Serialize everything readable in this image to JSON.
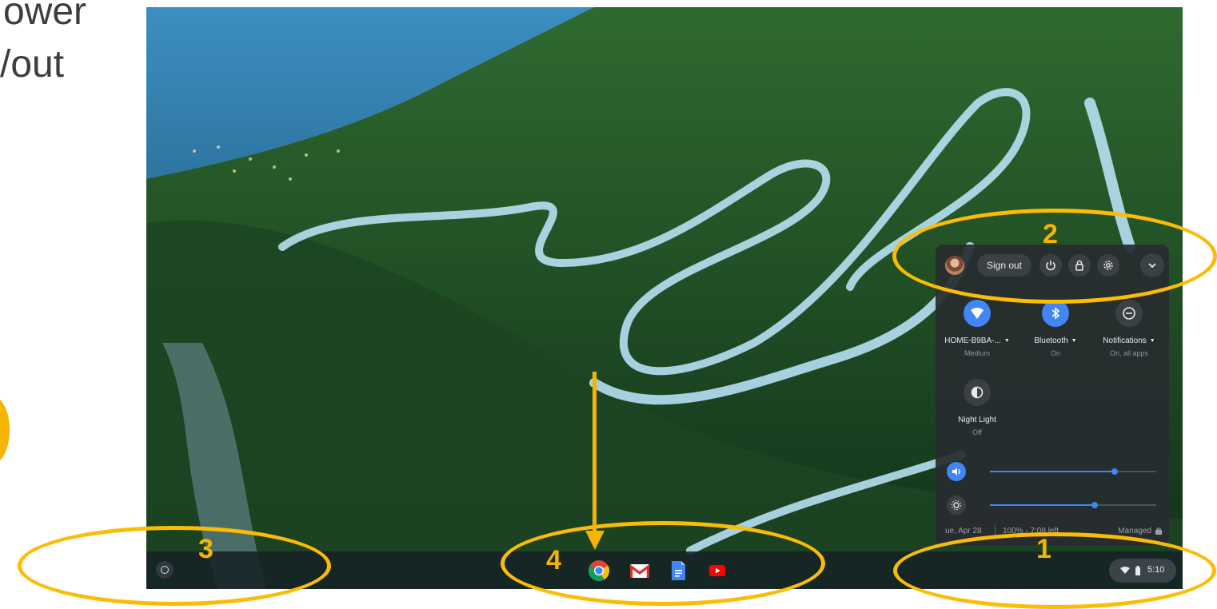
{
  "slide": {
    "lines": [
      "ower",
      "/out"
    ]
  },
  "quick_settings": {
    "sign_out_label": "Sign out",
    "tiles": [
      {
        "label": "HOME-B9BA-...",
        "sublabel": "Medium",
        "icon": "wifi-icon",
        "active": true
      },
      {
        "label": "Bluetooth",
        "sublabel": "On",
        "icon": "bluetooth-icon",
        "active": true
      },
      {
        "label": "Notifications",
        "sublabel": "On, all apps",
        "icon": "do-not-disturb-icon",
        "active": false
      },
      {
        "label": "Night Light",
        "sublabel": "Off",
        "icon": "night-light-icon",
        "active": false
      }
    ],
    "sliders": {
      "volume": {
        "icon": "volume-icon",
        "value": 0.75
      },
      "brightness": {
        "icon": "brightness-icon",
        "value": 0.63
      }
    },
    "footer": {
      "date": "ue, Apr 28",
      "battery": "100% - 7:08 left",
      "managed": "Managed"
    }
  },
  "shelf": {
    "apps": [
      "chrome-icon",
      "gmail-icon",
      "docs-icon",
      "youtube-icon"
    ],
    "time": "5:10"
  },
  "annotations": {
    "labels": [
      "1",
      "2",
      "3",
      "4"
    ]
  },
  "colors": {
    "accent": "#4285f4",
    "annotation": "#fbbc05"
  }
}
